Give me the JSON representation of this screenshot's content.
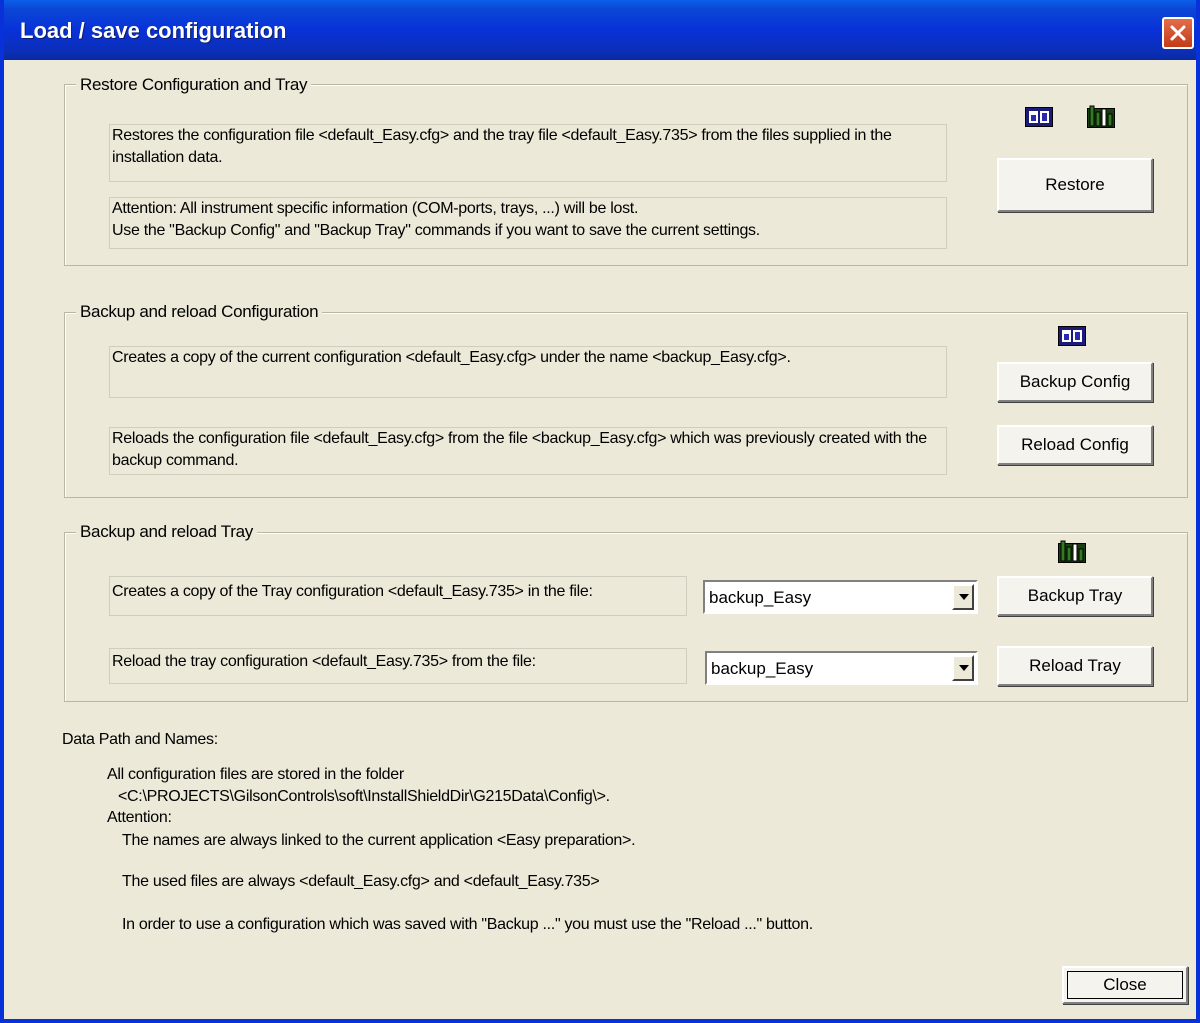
{
  "window": {
    "title": "Load / save configuration"
  },
  "restore": {
    "legend": "Restore Configuration and Tray",
    "desc1": "Restores the configuration file <default_Easy.cfg> and the tray file <default_Easy.735> from the files supplied in the installation data.",
    "desc2_line1": "Attention:  All instrument specific information (COM-ports, trays, ...) will be lost.",
    "desc2_line2": "Use the \"Backup Config\" and \"Backup Tray\" commands if you want to save the current settings.",
    "button": "Restore"
  },
  "backup_config": {
    "legend": "Backup and reload Configuration",
    "desc1": "Creates a copy of the current configuration <default_Easy.cfg> under the name <backup_Easy.cfg>.",
    "desc2": "Reloads the configuration file <default_Easy.cfg> from the file <backup_Easy.cfg> which was previously created with the backup command.",
    "backup_button": "Backup Config",
    "reload_button": "Reload Config"
  },
  "backup_tray": {
    "legend": "Backup and reload Tray",
    "desc1": "Creates a copy of the Tray configuration <default_Easy.735> in the file:",
    "desc2": "Reload the tray configuration <default_Easy.735> from the file:",
    "backup_select": "backup_Easy",
    "reload_select": "backup_Easy",
    "backup_button": "Backup Tray",
    "reload_button": "Reload Tray"
  },
  "info": {
    "heading": "Data Path and Names:",
    "line1": "All configuration files are stored in the folder",
    "line2": "<C:\\PROJECTS\\GilsonControls\\soft\\InstallShieldDir\\G215Data\\Config\\>.",
    "line3": "Attention:",
    "line4": "The names are always linked to the current application <Easy preparation>.",
    "line5": "The used files are always <default_Easy.cfg> and <default_Easy.735>",
    "line6": "In order to use a configuration which was saved with \"Backup ...\" you must use the \"Reload ...\" button."
  },
  "footer": {
    "close_button": "Close"
  },
  "icons": {
    "config": "config-chart-icon",
    "tray": "tray-chart-icon",
    "close": "close-icon",
    "dropdown": "chevron-down-icon"
  },
  "colors": {
    "titlebar": "#0831d9",
    "dialog_bg": "#ece9d8",
    "close_button": "#d4502b"
  }
}
